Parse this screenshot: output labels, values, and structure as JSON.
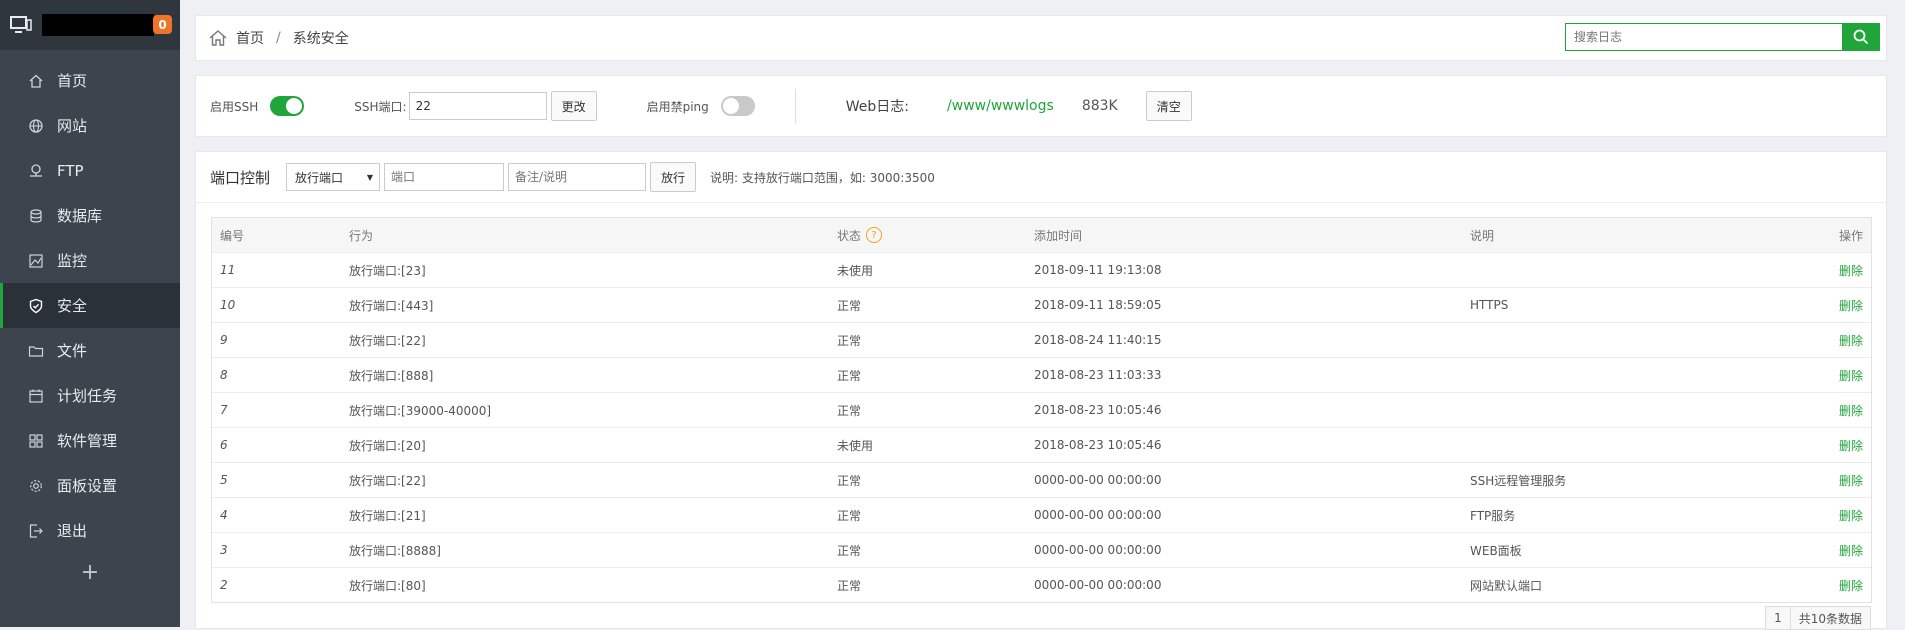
{
  "sidebar": {
    "badge": "0",
    "items": [
      {
        "label": "首页",
        "icon": "home-icon",
        "active": false
      },
      {
        "label": "网站",
        "icon": "globe-icon",
        "active": false
      },
      {
        "label": "FTP",
        "icon": "ftp-icon",
        "active": false
      },
      {
        "label": "数据库",
        "icon": "database-icon",
        "active": false
      },
      {
        "label": "监控",
        "icon": "monitor-icon",
        "active": false
      },
      {
        "label": "安全",
        "icon": "shield-icon",
        "active": true
      },
      {
        "label": "文件",
        "icon": "folder-icon",
        "active": false
      },
      {
        "label": "计划任务",
        "icon": "calendar-icon",
        "active": false
      },
      {
        "label": "软件管理",
        "icon": "grid-icon",
        "active": false
      },
      {
        "label": "面板设置",
        "icon": "gear-icon",
        "active": false
      },
      {
        "label": "退出",
        "icon": "logout-icon",
        "active": false
      }
    ],
    "add": "+"
  },
  "breadcrumb": {
    "home": "首页",
    "sep": "/",
    "current": "系统安全"
  },
  "search": {
    "placeholder": "搜索日志"
  },
  "ssh": {
    "enable_label": "启用SSH",
    "port_label": "SSH端口:",
    "port_value": "22",
    "change_btn": "更改",
    "ping_label": "启用禁ping",
    "weblog_label": "Web日志:",
    "weblog_path": "/www/wwwlogs",
    "weblog_size": "883K",
    "clear_btn": "清空"
  },
  "ports": {
    "title": "端口控制",
    "select_value": "放行端口",
    "port_placeholder": "端口",
    "note_placeholder": "备注/说明",
    "allow_btn": "放行",
    "hint": "说明: 支持放行端口范围，如: 3000:3500",
    "columns": {
      "id": "编号",
      "action": "行为",
      "status": "状态",
      "time": "添加时间",
      "desc": "说明",
      "op": "操作"
    },
    "rows": [
      {
        "id": "11",
        "action": "放行端口:[23]",
        "status": "未使用",
        "time": "2018-09-11 19:13:08",
        "desc": "",
        "op": "删除"
      },
      {
        "id": "10",
        "action": "放行端口:[443]",
        "status": "正常",
        "time": "2018-09-11 18:59:05",
        "desc": "HTTPS",
        "op": "删除"
      },
      {
        "id": "9",
        "action": "放行端口:[22]",
        "status": "正常",
        "time": "2018-08-24 11:40:15",
        "desc": "",
        "op": "删除"
      },
      {
        "id": "8",
        "action": "放行端口:[888]",
        "status": "正常",
        "time": "2018-08-23 11:03:33",
        "desc": "",
        "op": "删除"
      },
      {
        "id": "7",
        "action": "放行端口:[39000-40000]",
        "status": "正常",
        "time": "2018-08-23 10:05:46",
        "desc": "",
        "op": "删除"
      },
      {
        "id": "6",
        "action": "放行端口:[20]",
        "status": "未使用",
        "time": "2018-08-23 10:05:46",
        "desc": "",
        "op": "删除"
      },
      {
        "id": "5",
        "action": "放行端口:[22]",
        "status": "正常",
        "time": "0000-00-00 00:00:00",
        "desc": "SSH远程管理服务",
        "op": "删除"
      },
      {
        "id": "4",
        "action": "放行端口:[21]",
        "status": "正常",
        "time": "0000-00-00 00:00:00",
        "desc": "FTP服务",
        "op": "删除"
      },
      {
        "id": "3",
        "action": "放行端口:[8888]",
        "status": "正常",
        "time": "0000-00-00 00:00:00",
        "desc": "WEB面板",
        "op": "删除"
      },
      {
        "id": "2",
        "action": "放行端口:[80]",
        "status": "正常",
        "time": "0000-00-00 00:00:00",
        "desc": "网站默认端口",
        "op": "删除"
      }
    ],
    "pager": {
      "page": "1",
      "total": "共10条数据"
    }
  }
}
